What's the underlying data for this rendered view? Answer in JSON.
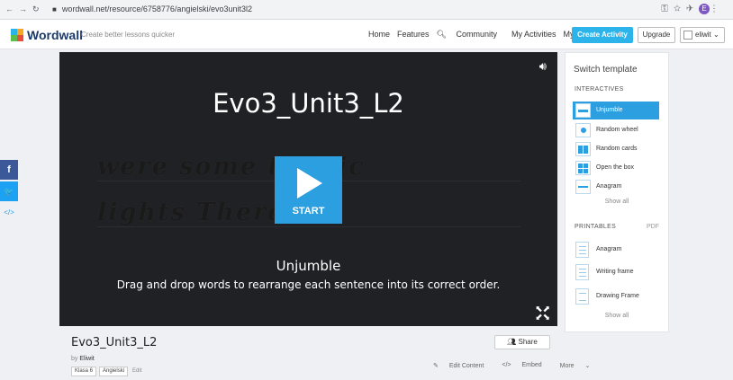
{
  "browser": {
    "url": "wordwall.net/resource/6758776/angielski/evo3unit3l2",
    "profile_initial": "E"
  },
  "header": {
    "logo": "Wordwall",
    "tagline": "Create better lessons quicker",
    "nav": [
      "Home",
      "Features",
      "Community",
      "My Activities",
      "My Results"
    ],
    "create_label": "Create Activity",
    "upgrade_label": "Upgrade",
    "user_name": "eliwit"
  },
  "social": [
    {
      "label": "f",
      "color": "#3b5998"
    },
    {
      "label": "🐦",
      "color": "#1da1f2"
    },
    {
      "label": "</>",
      "color": "#eef0f3"
    }
  ],
  "stage": {
    "title": "Evo3_Unit3_L2",
    "bg_lines": [
      "were some traffic",
      "lights There"
    ],
    "start_label": "START",
    "template_name": "Unjumble",
    "template_desc": "Drag and drop words to rearrange each sentence into its correct order."
  },
  "panel": {
    "heading": "Switch template",
    "interactives_label": "INTERACTIVES",
    "interactives": [
      "Unjumble",
      "Random wheel",
      "Random cards",
      "Open the box",
      "Anagram"
    ],
    "show_all": "Show all",
    "printables_label": "PRINTABLES",
    "pdf_label": "PDF",
    "printables": [
      "Anagram",
      "Writing frame",
      "Drawing Frame"
    ]
  },
  "info": {
    "title": "Evo3_Unit3_L2",
    "by_prefix": "by",
    "author": "Eliwit",
    "tags": [
      "Klasa 6",
      "Angielski"
    ],
    "edit_label": "Edit",
    "share_label": "Share",
    "edit_content": "Edit Content",
    "embed": "Embed",
    "more": "More"
  },
  "colors": {
    "accent": "#2b9fe0",
    "create_button": "#2bb3ea",
    "stage_bg": "#202124"
  }
}
